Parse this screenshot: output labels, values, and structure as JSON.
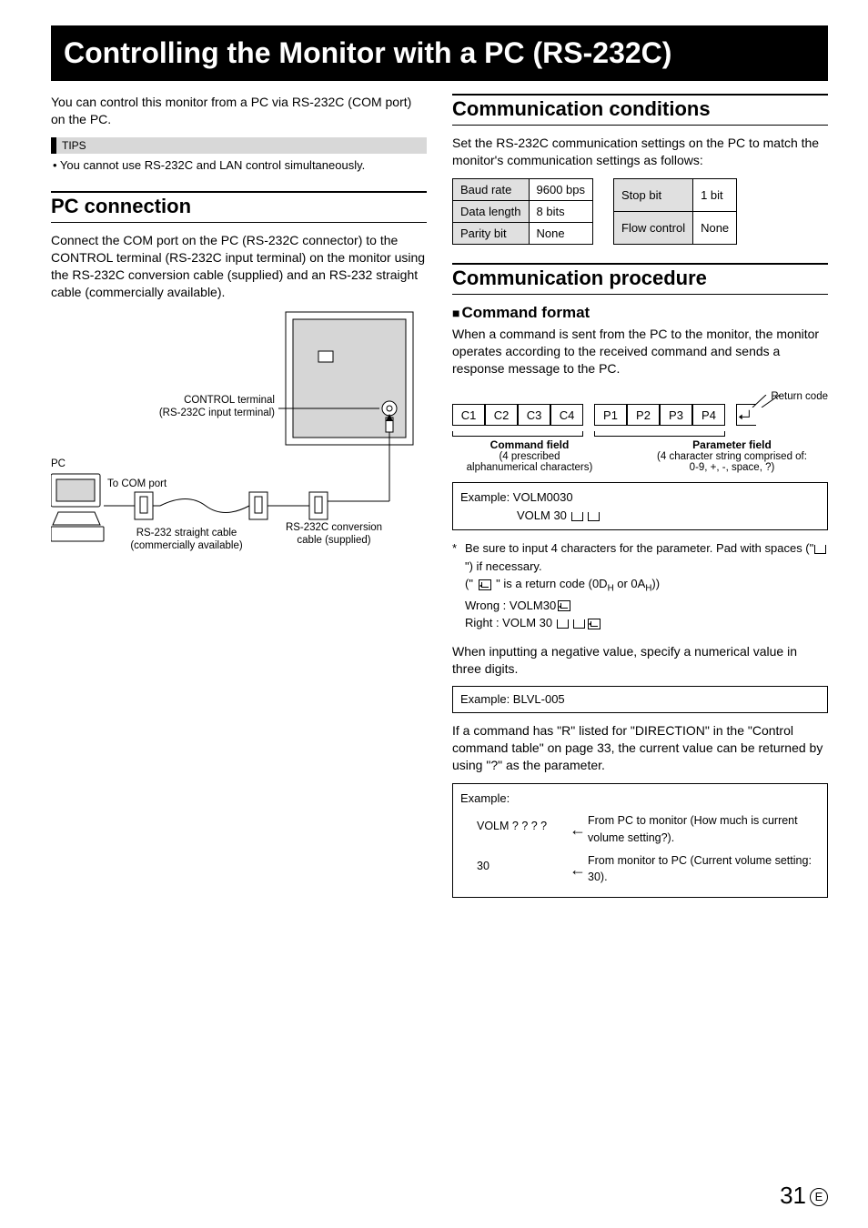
{
  "title": "Controlling the Monitor with a PC (RS-232C)",
  "intro": "You can control this monitor from a PC via RS-232C (COM port) on the PC.",
  "tips_label": "TIPS",
  "tip1": "•  You cannot use RS-232C and LAN control simultaneously.",
  "pc_conn": {
    "heading": "PC connection",
    "body": "Connect the COM port on the PC (RS-232C connector) to the CONTROL terminal (RS-232C input terminal) on the monitor using the RS-232C conversion cable (supplied) and an RS-232 straight cable (commercially available).",
    "labels": {
      "control_terminal": "CONTROL terminal\n(RS-232C input terminal)",
      "pc": "PC",
      "to_com": "To COM port",
      "straight": "RS-232 straight cable\n(commercially available)",
      "conv": "RS-232C conversion\ncable (supplied)"
    }
  },
  "comm_cond": {
    "heading": "Communication conditions",
    "body": "Set the RS-232C communication settings on the PC to match the monitor's communication settings as follows:",
    "t1": [
      [
        "Baud rate",
        "9600 bps"
      ],
      [
        "Data length",
        "8 bits"
      ],
      [
        "Parity bit",
        "None"
      ]
    ],
    "t2": [
      [
        "Stop bit",
        "1 bit"
      ],
      [
        "Flow control",
        "None"
      ]
    ]
  },
  "comm_proc": {
    "heading": "Communication procedure",
    "cmd_fmt": "Command format",
    "cmd_body": "When a command is sent from the PC to the monitor, the monitor operates according to the received command and sends a response message to the PC.",
    "ret_code": "Return code",
    "cells": [
      "C1",
      "C2",
      "C3",
      "C4",
      "P1",
      "P2",
      "P3",
      "P4"
    ],
    "cmd_field_t": "Command field",
    "cmd_field_b": "(4 prescribed\nalphanumerical characters)",
    "param_field_t": "Parameter field",
    "param_field_b": "(4 character string comprised of:\n0-9, +, -, space, ?)",
    "ex1_l1": "Example:  VOLM0030",
    "ex1_l2": "VOLM 30",
    "note_star": "*",
    "note_body1": "Be sure to input 4 characters for the parameter. Pad with spaces (\"",
    "note_body1b": "\") if necessary.",
    "note_body2a": "(\" ",
    "note_body2b": " \" is a return code (0D",
    "note_body2c": " or 0A",
    "note_body2d": "))",
    "wrong_l": "Wrong   : VOLM30",
    "right_l": "Right     : VOLM 30",
    "neg_body": "When inputting a negative value, specify a numerical value in three digits.",
    "ex2": "Example: BLVL-005",
    "q_body": "If a command has \"R\" listed for \"DIRECTION\" in the \"Control command table\" on page 33, the current value can be returned by using \"?\" as the parameter.",
    "q_ex_label": "Example:",
    "q_r1_cmd": "VOLM ? ? ? ?",
    "q_r1_desc": "From PC to monitor (How much is current volume setting?).",
    "q_r2_cmd": "30",
    "q_r2_desc": "From monitor to PC (Current volume setting: 30).",
    "H": "H"
  },
  "page_num": "31",
  "page_e": "E"
}
